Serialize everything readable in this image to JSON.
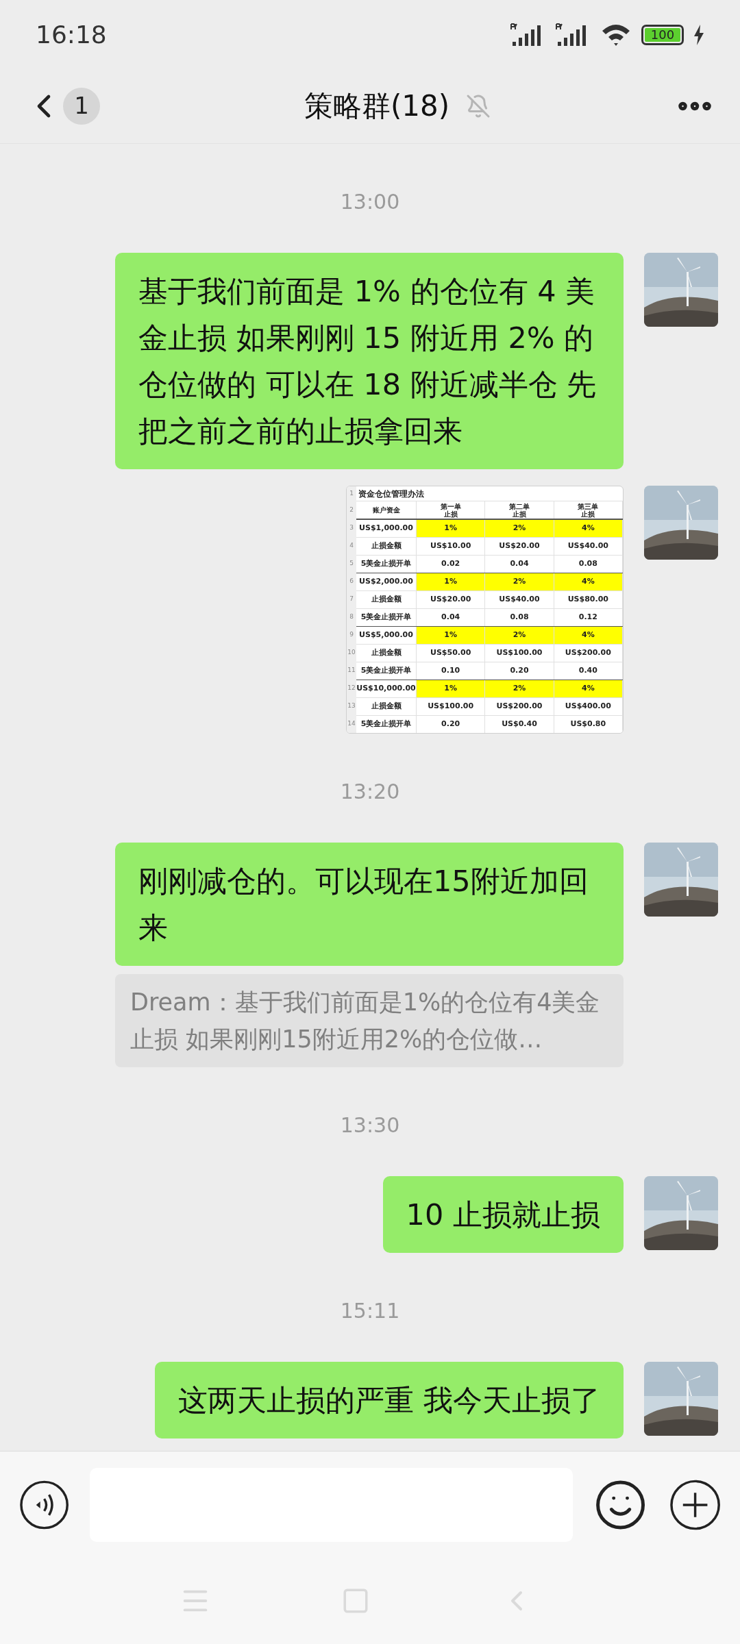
{
  "status_bar": {
    "time": "16:18",
    "battery": "100"
  },
  "header": {
    "unread_count": "1",
    "title": "策略群(18)",
    "muted": true
  },
  "messages": [
    {
      "kind": "time",
      "text": "13:00"
    },
    {
      "kind": "text",
      "text": "基于我们前面是 1% 的仓位有 4 美金止损  如果刚刚 15 附近用 2% 的仓位做的   可以在 18 附近减半仓 先把之前之前的止损拿回来"
    },
    {
      "kind": "sheet",
      "sheet": {
        "title": "资金仓位管理办法",
        "columns": [
          "账户资金",
          "第一单止损",
          "第二单止损",
          "第三单止损"
        ],
        "row_numbers": [
          "1",
          "2",
          "3",
          "4",
          "5",
          "6",
          "7",
          "8",
          "9",
          "10",
          "11",
          "12",
          "13",
          "14"
        ],
        "rows": [
          {
            "highlighted": true,
            "cells": [
              "US$1,000.00",
              "1%",
              "2%",
              "4%"
            ]
          },
          {
            "highlighted": false,
            "cells": [
              "止损金额",
              "US$10.00",
              "US$20.00",
              "US$40.00"
            ]
          },
          {
            "highlighted": false,
            "cells": [
              "5美金止损开单",
              "0.02",
              "0.04",
              "0.08"
            ]
          },
          {
            "highlighted": true,
            "cells": [
              "US$2,000.00",
              "1%",
              "2%",
              "4%"
            ]
          },
          {
            "highlighted": false,
            "cells": [
              "止损金额",
              "US$20.00",
              "US$40.00",
              "US$80.00"
            ]
          },
          {
            "highlighted": false,
            "cells": [
              "5美金止损开单",
              "0.04",
              "0.08",
              "0.12"
            ]
          },
          {
            "highlighted": true,
            "cells": [
              "US$5,000.00",
              "1%",
              "2%",
              "4%"
            ]
          },
          {
            "highlighted": false,
            "cells": [
              "止损金额",
              "US$50.00",
              "US$100.00",
              "US$200.00"
            ]
          },
          {
            "highlighted": false,
            "cells": [
              "5美金止损开单",
              "0.10",
              "0.20",
              "0.40"
            ]
          },
          {
            "highlighted": true,
            "cells": [
              "US$10,000.00",
              "1%",
              "2%",
              "4%"
            ]
          },
          {
            "highlighted": false,
            "cells": [
              "止损金额",
              "US$100.00",
              "US$200.00",
              "US$400.00"
            ]
          },
          {
            "highlighted": false,
            "cells": [
              "5美金止损开单",
              "0.20",
              "US$0.40",
              "US$0.80"
            ]
          }
        ]
      }
    },
    {
      "kind": "time",
      "text": "13:20"
    },
    {
      "kind": "text",
      "text": "刚刚减仓的。可以现在15附近加回来",
      "quote": "Dream：基于我们前面是1%的仓位有4美金止损  如果刚刚15附近用2%的仓位做…"
    },
    {
      "kind": "time",
      "text": "13:30"
    },
    {
      "kind": "text",
      "text": "10 止损就止损"
    },
    {
      "kind": "time",
      "text": "15:11"
    },
    {
      "kind": "text",
      "text": "这两天止损的严重  我今天止损了"
    }
  ]
}
